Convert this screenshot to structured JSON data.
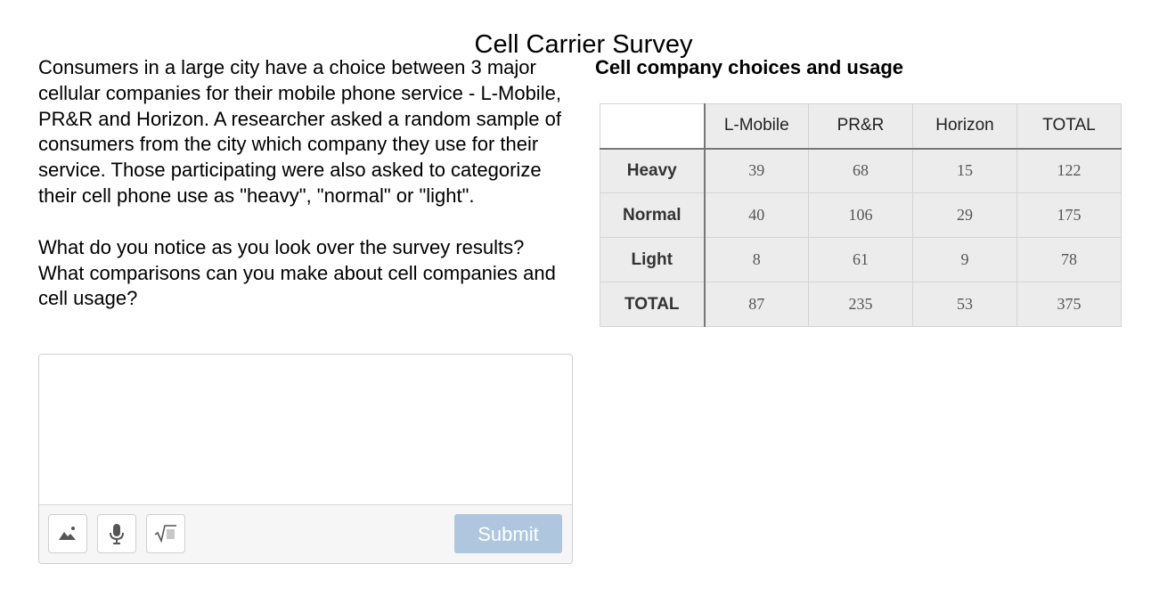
{
  "page": {
    "title": "Cell Carrier Survey"
  },
  "prompt": {
    "paragraph1": "Consumers in a large city have a choice between 3 major cellular companies for their mobile phone service - L-Mobile, PR&R and Horizon. A researcher asked a random sample of consumers from the city which company they use for their service. Those participating were also asked to categorize their cell phone use as \"heavy\", \"normal\" or \"light\".",
    "paragraph2": "What do you notice as you look over the survey results? What comparisons can you make about cell companies and cell usage?"
  },
  "answer": {
    "value": "",
    "placeholder": ""
  },
  "toolbar": {
    "tools": [
      {
        "icon": "image-icon"
      },
      {
        "icon": "microphone-icon"
      },
      {
        "icon": "math-equation-icon"
      }
    ],
    "submit_label": "Submit",
    "submit_enabled": false
  },
  "table": {
    "heading": "Cell company choices and usage",
    "corner": "",
    "columns": [
      "L-Mobile",
      "PR&R",
      "Horizon",
      "TOTAL"
    ],
    "rows": [
      {
        "label": "Heavy",
        "cells": [
          "39",
          "68",
          "15",
          "122"
        ]
      },
      {
        "label": "Normal",
        "cells": [
          "40",
          "106",
          "29",
          "175"
        ]
      },
      {
        "label": "Light",
        "cells": [
          "8",
          "61",
          "9",
          "78"
        ]
      },
      {
        "label": "TOTAL",
        "cells": [
          "87",
          "235",
          "53",
          "375"
        ]
      }
    ]
  },
  "colors": {
    "submit_disabled": "#aec7df",
    "table_background": "#ececec",
    "toolbar_background": "#f6f6f6"
  }
}
